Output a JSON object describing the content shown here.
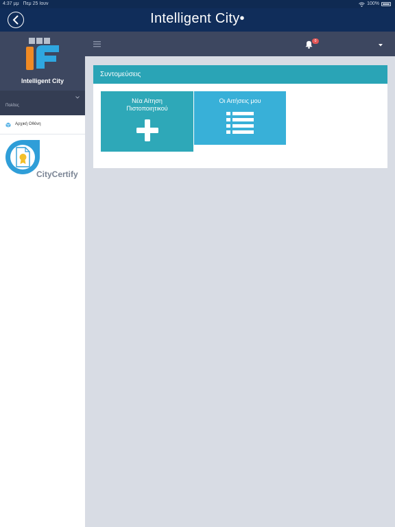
{
  "status_bar": {
    "time": "4:37 μμ",
    "date": "Πεμ 25 Ιουν",
    "battery": "100%"
  },
  "app_bar": {
    "title": "Intelligent City"
  },
  "sidebar": {
    "brand_name": "Intelligent City",
    "section_label": "Πολίτες",
    "nav_items": [
      {
        "label": "Αρχική Οθόνη",
        "icon": "cube-icon"
      }
    ],
    "certify_name": "CityCertify"
  },
  "toolbar": {
    "notification_count": "0"
  },
  "panel": {
    "title": "Συντομεύσεις",
    "tiles": [
      {
        "label_line1": "Νέα Αίτηση",
        "label_line2": "Πιστοποιητικού",
        "icon": "plus-icon"
      },
      {
        "label_line1": "Οι Αιτήσεις μου",
        "icon": "list-icon"
      }
    ]
  },
  "colors": {
    "app_bar": "#102d5a",
    "sidebar_header": "#3d4760",
    "panel_header": "#2aa4b6",
    "tile_new": "#2ea8b8",
    "tile_mine": "#38b0d8",
    "background": "#d8dce4"
  }
}
